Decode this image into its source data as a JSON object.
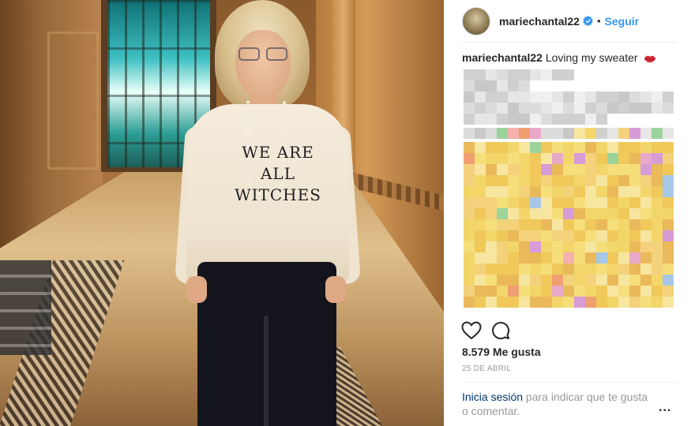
{
  "post": {
    "username": "mariechantal22",
    "follow_label": "Seguir",
    "separator": "•",
    "caption_user": "mariechantal22",
    "caption_text": " Loving my sweater",
    "sweater_lines": [
      "WE ARE",
      "ALL",
      "WITCHES"
    ],
    "likes": "8.579 Me gusta",
    "date": "25 DE ABRIL",
    "login_link": "Inicia sesión",
    "login_rest": " para indicar que te gusta o comentar.",
    "more_label": "..."
  },
  "icons": {
    "verified": "verified-badge-icon",
    "like": "heart-icon",
    "comment": "comment-icon",
    "lips": "lips-emoji-icon",
    "more": "more-options-icon"
  },
  "colors": {
    "link_blue": "#3897f0",
    "login_link": "#003569",
    "text": "#262626",
    "muted": "#999999"
  }
}
